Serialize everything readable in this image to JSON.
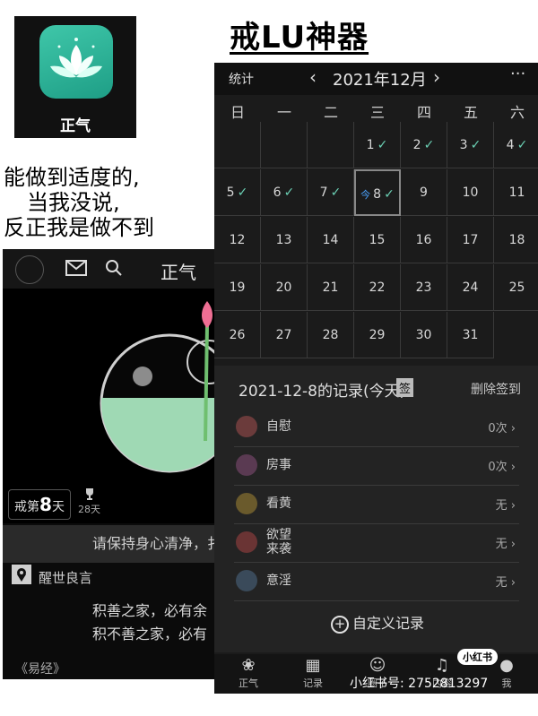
{
  "app_icon": {
    "label": "正气"
  },
  "headline": "戒LU神器",
  "caption": [
    "能做到适度的,",
    "当我没说,",
    "反正我是做不到"
  ],
  "home": {
    "title": "正气",
    "abstain_prefix": "戒第",
    "abstain_days": "8",
    "abstain_suffix": "天",
    "trophy_days": "28天",
    "banner": "请保持身心清净，扌",
    "wise_heading": "醒世良言",
    "quote_line1": "积善之家，必有余",
    "quote_line2": "积不善之家，必有",
    "quote_source": "《易经》"
  },
  "calendar": {
    "stat_label": "统计",
    "month": "2021年12月",
    "more": "···",
    "weekdays": [
      "日",
      "一",
      "二",
      "三",
      "四",
      "五",
      "六"
    ],
    "today_mark": "今",
    "checked_days": [
      1,
      2,
      3,
      4,
      5,
      6,
      7,
      8
    ],
    "today": 8,
    "first_weekday": 3,
    "days_in_month": 31
  },
  "records": {
    "title": "2021-12-8的记录(今天)",
    "sign_chip": "签",
    "delete_sign": "删除签到",
    "items": [
      {
        "name": "自慰",
        "value": "0次",
        "color": "#6b3b3b"
      },
      {
        "name": "房事",
        "value": "0次",
        "color": "#5a3a52"
      },
      {
        "name": "看黄",
        "value": "无",
        "color": "#6a5a2c"
      },
      {
        "name": "欲望\n来袭",
        "value": "无",
        "color": "#6a3434"
      },
      {
        "name": "意淫",
        "value": "无",
        "color": "#3a4a5a"
      }
    ],
    "add_custom": "自定义记录"
  },
  "tabbar": {
    "tabs": [
      {
        "label": "正气",
        "icon": "lotus-icon"
      },
      {
        "label": "记录",
        "icon": "calendar-icon"
      },
      {
        "label": "圈子",
        "icon": "circle-icon"
      },
      {
        "label": "内容",
        "icon": "music-icon"
      },
      {
        "label": "我",
        "icon": "person-icon"
      }
    ]
  },
  "watermark": {
    "badge": "小红书",
    "text": "小红书号: 2752813297"
  },
  "colors": {
    "accent": "#2ab59a",
    "check": "#6bd0b4",
    "today_blue": "#4aa3ff"
  }
}
